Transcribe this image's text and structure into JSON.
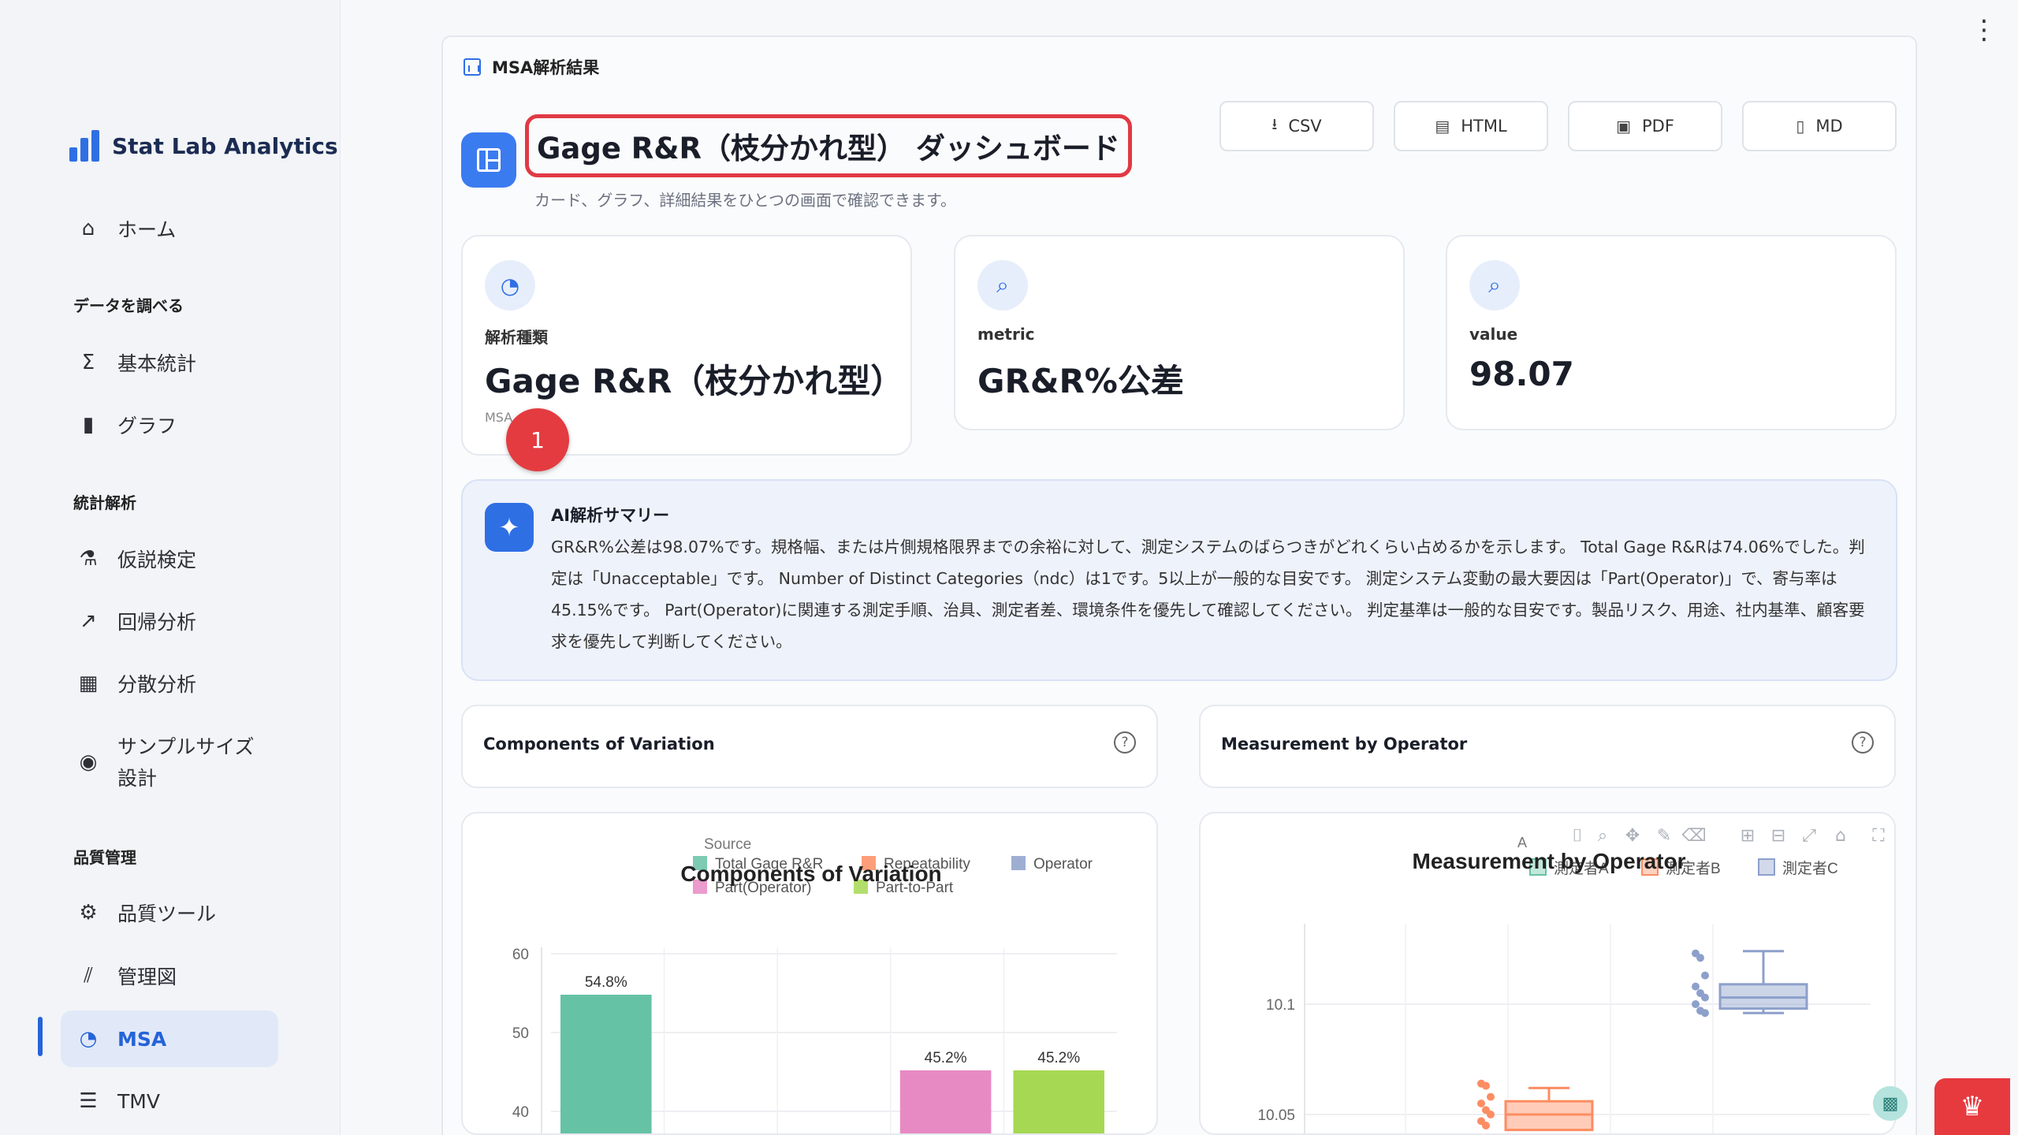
{
  "app": {
    "name": "Stat Lab Analytics"
  },
  "nav": {
    "home": "ホーム",
    "section_explore": "データを調べる",
    "basic_stats": "基本統計",
    "graph": "グラフ",
    "section_analysis": "統計解析",
    "hypothesis": "仮説検定",
    "regression": "回帰分析",
    "anova": "分散分析",
    "sample_size": "サンプルサイズ設計",
    "section_quality": "品質管理",
    "quality_tools": "品質ツール",
    "control_chart": "管理図",
    "msa": "MSA",
    "tmv": "TMV"
  },
  "header": {
    "tab_label": "MSA解析結果",
    "title": "Gage R&R（枝分かれ型） ダッシュボード",
    "subtitle": "カード、グラフ、詳細結果をひとつの画面で確認できます。"
  },
  "exports": {
    "csv": "CSV",
    "html": "HTML",
    "pdf": "PDF",
    "md": "MD"
  },
  "kpis": [
    {
      "label": "解析種類",
      "value": "Gage R&R（枝分かれ型）",
      "foot": "MSA"
    },
    {
      "label": "metric",
      "value": "GR&R%公差"
    },
    {
      "label": "value",
      "value": "98.07"
    }
  ],
  "badge": "1",
  "summary": {
    "title": "AI解析サマリー",
    "text": "GR&R%公差は98.07%です。規格幅、または片側規格限界までの余裕に対して、測定システムのばらつきがどれくらい占めるかを示します。 Total Gage R&Rは74.06%でした。判定は「Unacceptable」です。 Number of Distinct Categories（ndc）は1です。5以上が一般的な目安です。 測定システム変動の最大要因は「Part(Operator)」で、寄与率は45.15%です。 Part(Operator)に関連する測定手順、治具、測定者差、環境条件を優先して確認してください。 判定基準は一般的な目安です。製品リスク、用途、社内基準、顧客要求を優先して判断してください。"
  },
  "panels": {
    "left_title": "Components of Variation",
    "right_title": "Measurement by Operator"
  },
  "chart_data": [
    {
      "type": "bar",
      "title": "Components of Variation",
      "legend_title": "Source",
      "legend_placement": "top",
      "categories": [
        "Total Gage R&R",
        "Repeatability",
        "Operator",
        "Part(Operator)",
        "Part-to-Part"
      ],
      "values": [
        54.8,
        null,
        null,
        45.2,
        45.2
      ],
      "labels": [
        "54.8%",
        "",
        "",
        "45.2%",
        "45.2%"
      ],
      "colors": [
        "#66c2a5",
        "#fc8d62",
        "#8da0cb",
        "#e78ac3",
        "#a6d854"
      ],
      "ylim": [
        35,
        62
      ],
      "yticks": [
        40,
        50,
        60
      ],
      "grid": true
    },
    {
      "type": "box",
      "title": "Measurement by Operator",
      "legend_title": "A",
      "legend_placement": "top",
      "series": [
        {
          "name": "測定者A",
          "color": "#66c2a5"
        },
        {
          "name": "測定者B",
          "color": "#fc8d62",
          "q1": 10.043,
          "median": 10.05,
          "q3": 10.056,
          "whisker_high": 10.062,
          "points": [
            10.064,
            10.063,
            10.058,
            10.055,
            10.052,
            10.05,
            10.047,
            10.045
          ]
        },
        {
          "name": "測定者C",
          "color": "#8da0cb",
          "q1": 10.098,
          "median": 10.103,
          "q3": 10.109,
          "whisker_high": 10.124,
          "whisker_low": 10.096,
          "points": [
            10.123,
            10.121,
            10.113,
            10.108,
            10.105,
            10.103,
            10.1,
            10.097,
            10.096
          ]
        }
      ],
      "yticks": [
        10.05,
        10.1
      ],
      "ylim": [
        10.035,
        10.14
      ],
      "grid": true
    }
  ]
}
